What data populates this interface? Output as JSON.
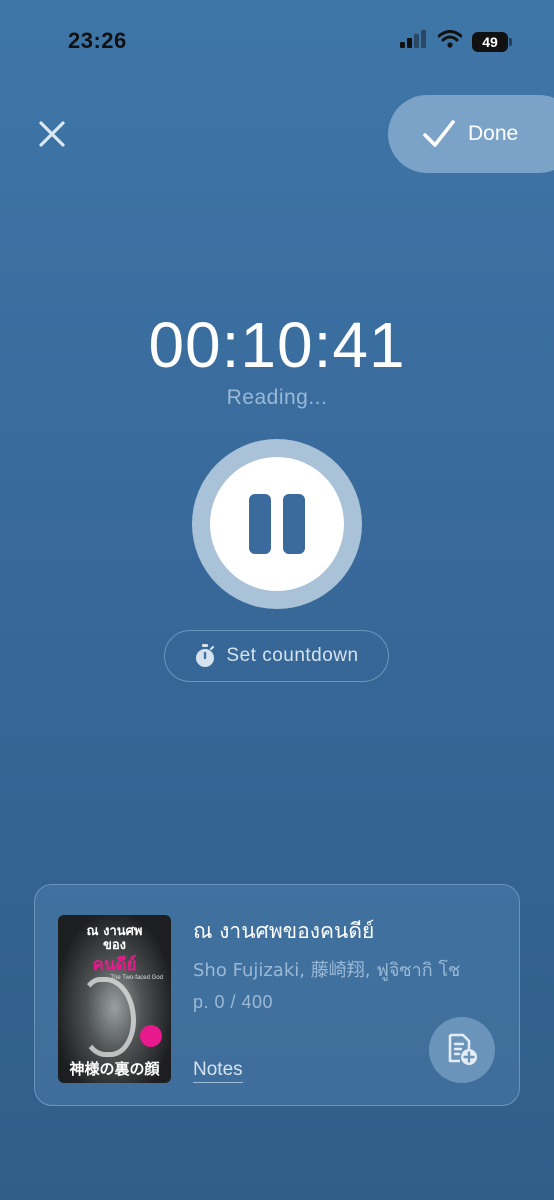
{
  "status_bar": {
    "time": "23:26",
    "battery": "49"
  },
  "header": {
    "done_label": "Done"
  },
  "timer": {
    "elapsed": "00:10:41",
    "status": "Reading..."
  },
  "countdown": {
    "label": "Set countdown"
  },
  "book": {
    "cover_title_line1": "ณ งานศพ",
    "cover_title_line2": "ของ",
    "cover_title_pink": "คนดีย์",
    "cover_subtitle": "The Two-faced God",
    "cover_japanese": "神様の裏の顔",
    "title": "ณ งานศพของคนดีย์",
    "author": "Sho Fujizaki, 藤崎翔, ฟูจิซากิ โช",
    "pages": "p. 0 / 400",
    "notes_label": "Notes"
  },
  "icons": {
    "close": "close-icon",
    "done": "checkmark-icon",
    "pause": "pause-icon",
    "stopwatch": "stopwatch-icon",
    "add_note": "add-note-icon",
    "signal": "cellular-signal-icon",
    "wifi": "wifi-icon",
    "battery": "battery-icon"
  },
  "colors": {
    "background_top": "#3f76a8",
    "background_bottom": "#315d89",
    "accent_pink": "#e8198c",
    "muted_text": "#9ab9d6"
  }
}
